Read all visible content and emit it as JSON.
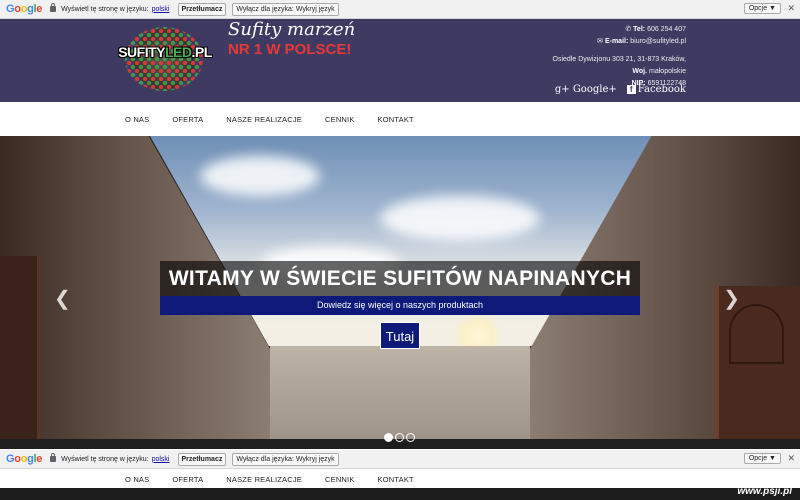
{
  "translate_bar": {
    "logo": {
      "g1": "G",
      "o1": "o",
      "o2": "o",
      "g2": "g",
      "l": "l",
      "e": "e"
    },
    "prompt": "Wyświetl tę stronę w języku:",
    "language": "polski",
    "translate_btn": "Przetłumacz",
    "disable_btn": "Wyłącz dla języka: Wykryj język",
    "options": "Opcje ▼",
    "close": "✕"
  },
  "header": {
    "logo_text_1": "SUFITY",
    "logo_text_2": "LED",
    "logo_text_3": ".PL",
    "slogan_1": "Sufity marzeń",
    "slogan_2": "NR 1 W POLSCE!",
    "contact": {
      "phone_label": "Tel:",
      "phone": "606 254 407",
      "email_label": "E-mail:",
      "email": "biuro@sufityled.pl",
      "address": "Osiedle Dywizjonu 303 21, 31-873 Kraków,",
      "region_label": "Woj.",
      "region": "małopolskie",
      "nip_label": "NIP:",
      "nip": "6591122748"
    },
    "social": {
      "google": "Google+",
      "facebook": "Facebook"
    }
  },
  "nav": [
    "O NAS",
    "OFERTA",
    "NASZE REALIZACJE",
    "CENNIK",
    "KONTAKT"
  ],
  "hero": {
    "title": "WITAMY W ŚWIECIE SUFITÓW NAPINANYCH",
    "subtitle": "Dowiedz się więcej o naszych produktach",
    "button": "Tutaj",
    "prev": "❮",
    "next": "❯",
    "slides": 3,
    "active_slide": 1
  },
  "watermark": "www.psji.pl",
  "colors": {
    "header_bg": "#3f3a62",
    "accent_blue": "#0e1a7a",
    "slogan_red": "#e53935"
  }
}
